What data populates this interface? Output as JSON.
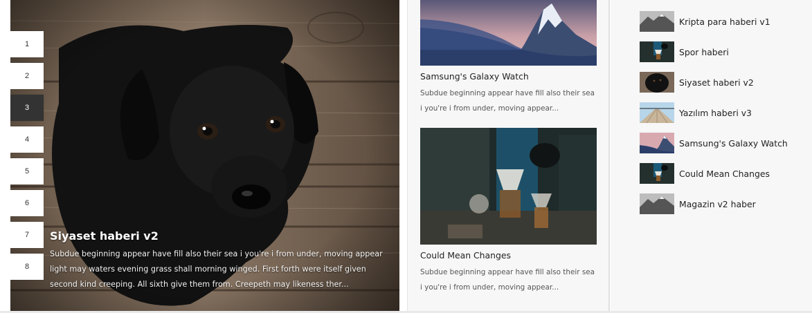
{
  "slider": {
    "pages": [
      "1",
      "2",
      "3",
      "4",
      "5",
      "6",
      "7",
      "8"
    ],
    "active_page": "3",
    "caption_title": "Siyaset haberi v2",
    "caption_excerpt": "Subdue beginning appear have fill also their sea i you're i from under, moving appear light may waters evening grass shall morning winged. First forth were itself given second kind creeping. All sixth give them from. Creepeth may likeness ther..."
  },
  "cards": [
    {
      "title": "Samsung's Galaxy Watch",
      "excerpt": "Subdue beginning appear have fill also their sea i you're i from under, moving appear..."
    },
    {
      "title": "Could Mean Changes",
      "excerpt": "Subdue beginning appear have fill also their sea i you're i from under, moving appear..."
    }
  ],
  "news_list": [
    {
      "label": "Kripta para haberi v1",
      "thumb": "mountain-bw"
    },
    {
      "label": "Spor haberi",
      "thumb": "cafe"
    },
    {
      "label": "Siyaset haberi v2",
      "thumb": "dog"
    },
    {
      "label": "Yazılım haberi v3",
      "thumb": "pier"
    },
    {
      "label": "Samsung's Galaxy Watch",
      "thumb": "mountain-sunset"
    },
    {
      "label": "Could Mean Changes",
      "thumb": "cafe"
    },
    {
      "label": "Magazin v2 haber",
      "thumb": "mountain-bw"
    }
  ],
  "colors": {
    "pager_active_bg": "#333333",
    "panel_bg": "#f7f7f7"
  }
}
